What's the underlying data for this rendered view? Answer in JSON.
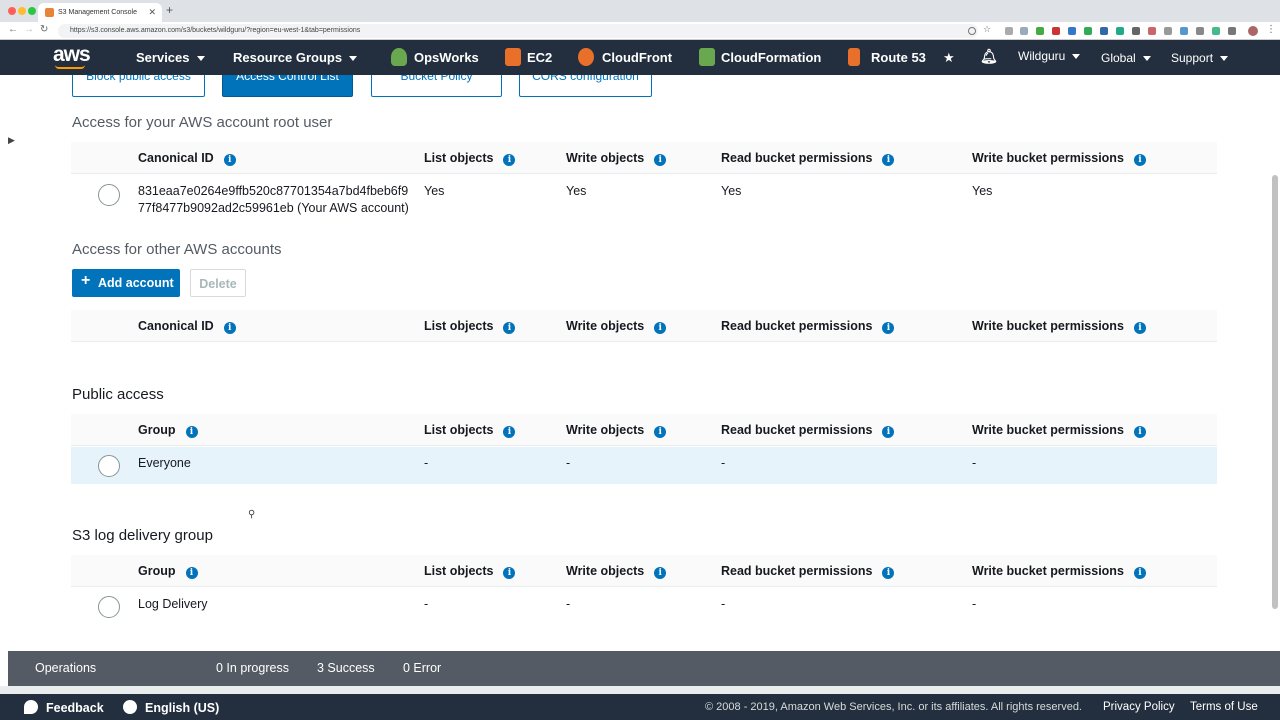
{
  "browser": {
    "tab_title": "S3 Management Console",
    "url": "https://s3.console.aws.amazon.com/s3/buckets/wildguru/?region=eu-west-1&tab=permissions"
  },
  "nav": {
    "logo": "aws",
    "services": "Services",
    "resource_groups": "Resource Groups",
    "opsworks": "OpsWorks",
    "ec2": "EC2",
    "cloudfront": "CloudFront",
    "cloudformation": "CloudFormation",
    "route53": "Route 53",
    "user": "Wildguru",
    "region": "Global",
    "support": "Support"
  },
  "subtabs": [
    {
      "label": "Block public access"
    },
    {
      "label": "Access Control List"
    },
    {
      "label": "Bucket Policy"
    },
    {
      "label": "CORS configuration"
    }
  ],
  "columns": {
    "canonical_id": "Canonical ID",
    "group": "Group",
    "list": "List objects",
    "write": "Write objects",
    "read_perm": "Read bucket permissions",
    "write_perm": "Write bucket permissions"
  },
  "root_section": {
    "title": "Access for your AWS account root user",
    "row": {
      "id_line1": "831eaa7e0264e9ffb520c87701354a7bd4fbeb6f9",
      "id_line2": "77f8477b9092ad2c59961eb (Your AWS account)",
      "list": "Yes",
      "write": "Yes",
      "read_perm": "Yes",
      "write_perm": "Yes"
    }
  },
  "other_section": {
    "title": "Access for other AWS accounts",
    "add_button": "Add account",
    "delete_button": "Delete"
  },
  "public_section": {
    "title": "Public access",
    "row": {
      "group": "Everyone",
      "list": "-",
      "write": "-",
      "read_perm": "-",
      "write_perm": "-"
    }
  },
  "log_section": {
    "title": "S3 log delivery group",
    "row": {
      "group": "Log Delivery",
      "list": "-",
      "write": "-",
      "read_perm": "-",
      "write_perm": "-"
    }
  },
  "operations": {
    "label": "Operations",
    "in_progress": "0 In progress",
    "success": "3 Success",
    "error": "0 Error"
  },
  "footer": {
    "feedback": "Feedback",
    "language": "English (US)",
    "copyright": "© 2008 - 2019, Amazon Web Services, Inc. or its affiliates. All rights reserved.",
    "privacy": "Privacy Policy",
    "terms": "Terms of Use"
  },
  "colors": {
    "nav_bg": "#232f3e",
    "accent": "#0073bb",
    "highlight_row": "#e6f3fb",
    "ops_bar": "#545b64"
  }
}
